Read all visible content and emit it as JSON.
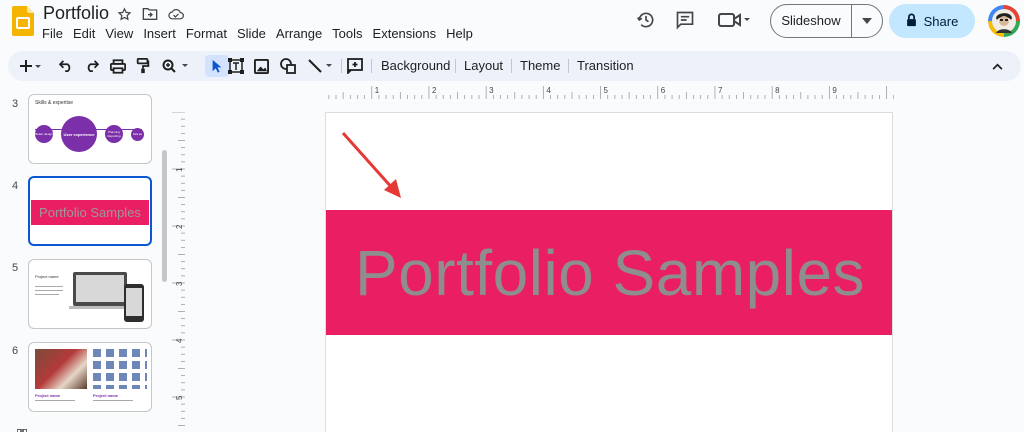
{
  "app": {
    "doc_title": "Portfolio",
    "menu": [
      "File",
      "Edit",
      "View",
      "Insert",
      "Format",
      "Slide",
      "Arrange",
      "Tools",
      "Extensions",
      "Help"
    ],
    "slideshow_label": "Slideshow",
    "share_label": "Share"
  },
  "toolbar": {
    "background_label": "Background",
    "layout_label": "Layout",
    "theme_label": "Theme",
    "transition_label": "Transition"
  },
  "rulers": {
    "horizontal_ticks": [
      "1",
      "2",
      "3",
      "4",
      "5",
      "6",
      "7",
      "8",
      "9"
    ],
    "vertical_ticks": [
      "1",
      "2",
      "3",
      "4",
      "5"
    ]
  },
  "filmstrip": {
    "slides": [
      {
        "number": "3",
        "title": "Skills & expertise",
        "circles": [
          "Better design",
          "User experience",
          "Planning Reporting",
          "Data pie"
        ]
      },
      {
        "number": "4",
        "title": "Portfolio Samples"
      },
      {
        "number": "5",
        "title": "Project name"
      },
      {
        "number": "6",
        "captions": [
          "Project name",
          "Project name"
        ]
      }
    ]
  },
  "slide": {
    "title": "Portfolio Samples",
    "banner_color": "#e91e63",
    "title_color": "#8e8e8e"
  },
  "colors": {
    "accent_blue": "#0b57d0",
    "share_bg": "#c2e7ff",
    "toolbar_bg": "#edf2fa",
    "arrow": "#e53935",
    "thumb_purple": "#7b2fa8"
  }
}
